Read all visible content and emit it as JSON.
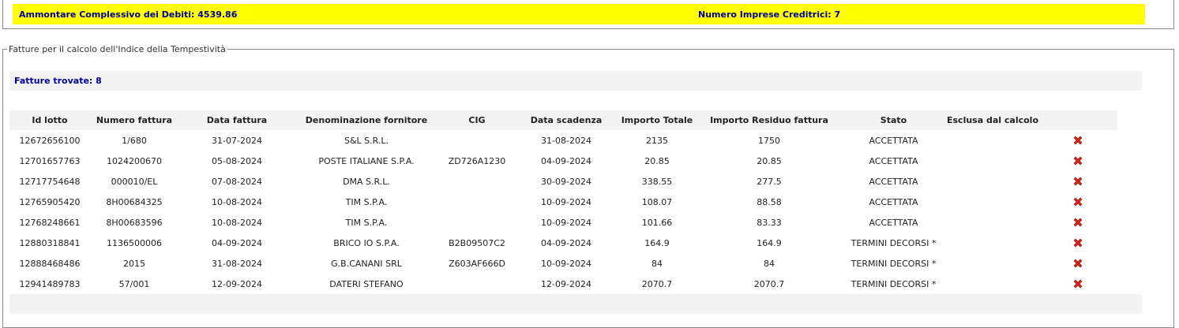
{
  "summary": {
    "total_debts": "Ammontare Complessivo dei Debiti: 4539.86",
    "creditor_firms": "Numero Imprese Creditrici: 7"
  },
  "invoices_section": {
    "legend": "Fatture per il calcolo dell'Indice della Tempestività",
    "found": "Fatture trovate: 8",
    "columns": [
      "Id lotto",
      "Numero fattura",
      "Data fattura",
      "Denominazione fornitore",
      "CIG",
      "Data scadenza",
      "Importo Totale",
      "Importo Residuo fattura",
      "Stato",
      "Esclusa dal calcolo"
    ],
    "rows": [
      {
        "id": "12672656100",
        "num": "1/680",
        "date": "31-07-2024",
        "supplier": "S&L S.R.L.",
        "cig": "",
        "due": "31-08-2024",
        "total": "2135",
        "residual": "1750",
        "status": "ACCETTATA"
      },
      {
        "id": "12701657763",
        "num": "1024200670",
        "date": "05-08-2024",
        "supplier": "POSTE ITALIANE S.P.A.",
        "cig": "ZD726A1230",
        "due": "04-09-2024",
        "total": "20.85",
        "residual": "20.85",
        "status": "ACCETTATA"
      },
      {
        "id": "12717754648",
        "num": "000010/EL",
        "date": "07-08-2024",
        "supplier": "DMA S.R.L.",
        "cig": "",
        "due": "30-09-2024",
        "total": "338.55",
        "residual": "277.5",
        "status": "ACCETTATA"
      },
      {
        "id": "12765905420",
        "num": "8H00684325",
        "date": "10-08-2024",
        "supplier": "TIM S.P.A.",
        "cig": "",
        "due": "10-09-2024",
        "total": "108.07",
        "residual": "88.58",
        "status": "ACCETTATA"
      },
      {
        "id": "12768248661",
        "num": "8H00683596",
        "date": "10-08-2024",
        "supplier": "TIM S.P.A.",
        "cig": "",
        "due": "10-09-2024",
        "total": "101.66",
        "residual": "83.33",
        "status": "ACCETTATA"
      },
      {
        "id": "12880318841",
        "num": "1136500006",
        "date": "04-09-2024",
        "supplier": "BRICO IO S.P.A.",
        "cig": "B2B09507C2",
        "due": "04-09-2024",
        "total": "164.9",
        "residual": "164.9",
        "status": "TERMINI DECORSI *"
      },
      {
        "id": "12888468486",
        "num": "2015",
        "date": "31-08-2024",
        "supplier": "G.B.CANANI SRL",
        "cig": "Z603AF666D",
        "due": "10-09-2024",
        "total": "84",
        "residual": "84",
        "status": "TERMINI DECORSI *"
      },
      {
        "id": "12941489783",
        "num": "57/001",
        "date": "12-09-2024",
        "supplier": "DATERI STEFANO",
        "cig": "",
        "due": "12-09-2024",
        "total": "2070.7",
        "residual": "2070.7",
        "status": "TERMINI DECORSI *"
      }
    ]
  },
  "icons": {
    "exclude": "red-x-icon",
    "exclude_color": "#d9261c"
  }
}
